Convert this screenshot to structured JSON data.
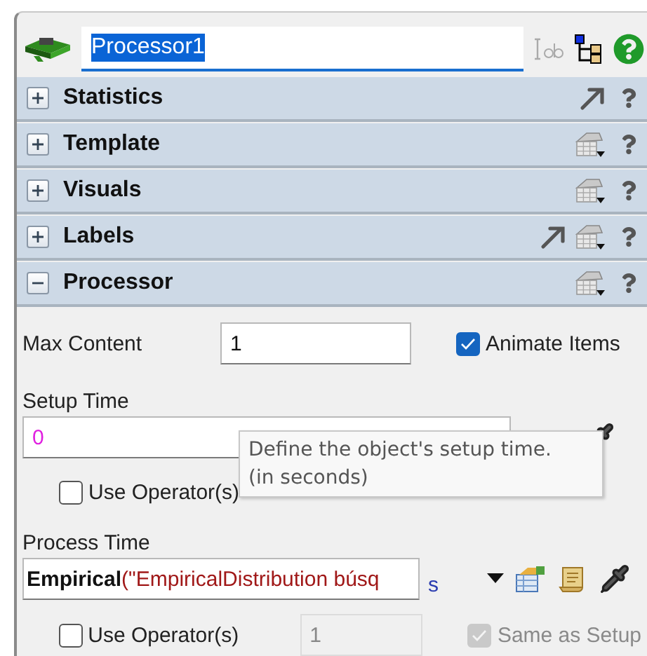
{
  "header": {
    "name": "Processor1"
  },
  "sections": [
    {
      "title": "Statistics",
      "expanded": false,
      "has_pointer": true,
      "has_menu": false
    },
    {
      "title": "Template",
      "expanded": false,
      "has_pointer": false,
      "has_menu": true
    },
    {
      "title": "Visuals",
      "expanded": false,
      "has_pointer": false,
      "has_menu": true
    },
    {
      "title": "Labels",
      "expanded": false,
      "has_pointer": true,
      "has_menu": true
    },
    {
      "title": "Processor",
      "expanded": true,
      "has_pointer": false,
      "has_menu": true
    }
  ],
  "processor": {
    "max_content": {
      "label": "Max Content",
      "value": "1"
    },
    "animate_items": {
      "label": "Animate Items",
      "checked": true
    },
    "setup_time": {
      "label": "Setup Time",
      "value": "0",
      "use_operators": {
        "label": "Use Operator(s)",
        "checked": false
      }
    },
    "tooltip": {
      "lines": [
        "Define the object's setup time.",
        "(in seconds)"
      ]
    },
    "process_time": {
      "label": "Process Time",
      "function": "Empirical",
      "args": "(\"EmpiricalDistribution búsq",
      "unit": "s",
      "use_operators": {
        "label": "Use Operator(s)",
        "checked": false,
        "count": "1"
      },
      "same_as_setup": {
        "label": "Same as Setup",
        "checked": true,
        "disabled": true
      }
    }
  }
}
